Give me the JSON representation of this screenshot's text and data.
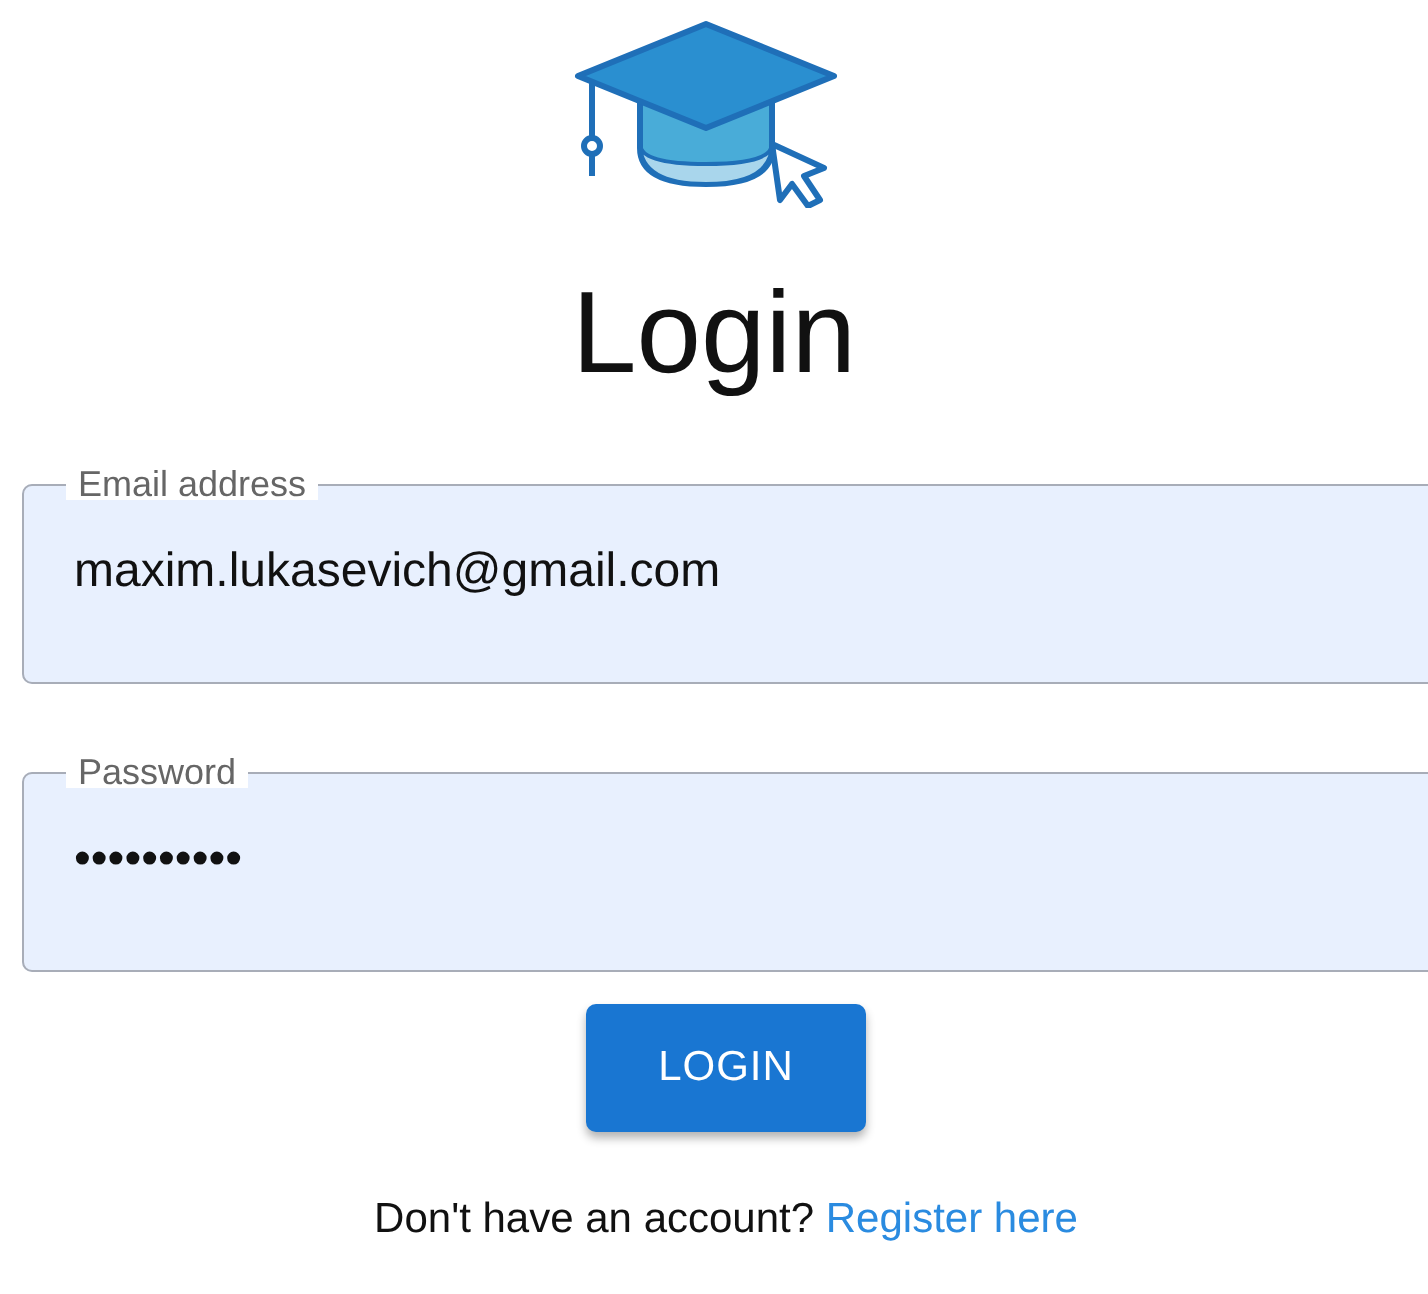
{
  "title": "Login",
  "fields": [
    {
      "label": "Email address",
      "value": "maxim.lukasevich@gmail.com"
    },
    {
      "label": "Password",
      "value": "••••••••••"
    }
  ],
  "button": "LOGIN",
  "footer": {
    "text": "Don't have an account?",
    "link": "Register here"
  }
}
